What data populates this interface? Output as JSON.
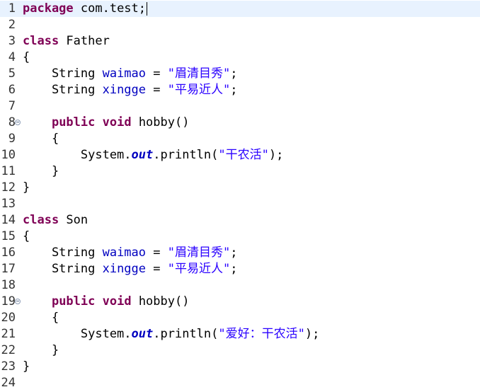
{
  "colors": {
    "keyword": "#7f0055",
    "field": "#0000c0",
    "string": "#2a00ff",
    "current_line": "#e8f2fe",
    "line_number": "#333333"
  },
  "lines": [
    {
      "n": "1",
      "fold": false,
      "current": true,
      "tokens": [
        [
          "kw",
          "package"
        ],
        [
          "txt",
          " com.test;"
        ]
      ]
    },
    {
      "n": "2",
      "fold": false,
      "tokens": []
    },
    {
      "n": "3",
      "fold": false,
      "tokens": [
        [
          "kw",
          "class"
        ],
        [
          "txt",
          " Father"
        ]
      ]
    },
    {
      "n": "4",
      "fold": false,
      "tokens": [
        [
          "txt",
          "{"
        ]
      ]
    },
    {
      "n": "5",
      "fold": false,
      "tokens": [
        [
          "txt",
          "    String "
        ],
        [
          "field",
          "waimao"
        ],
        [
          "txt",
          " = "
        ],
        [
          "str",
          "\"眉清目秀\""
        ],
        [
          "txt",
          ";"
        ]
      ]
    },
    {
      "n": "6",
      "fold": false,
      "tokens": [
        [
          "txt",
          "    String "
        ],
        [
          "field",
          "xingge"
        ],
        [
          "txt",
          " = "
        ],
        [
          "str",
          "\"平易近人\""
        ],
        [
          "txt",
          ";"
        ]
      ]
    },
    {
      "n": "7",
      "fold": false,
      "tokens": []
    },
    {
      "n": "8",
      "fold": true,
      "tokens": [
        [
          "txt",
          "    "
        ],
        [
          "kw",
          "public"
        ],
        [
          "txt",
          " "
        ],
        [
          "kw",
          "void"
        ],
        [
          "txt",
          " hobby()"
        ]
      ]
    },
    {
      "n": "9",
      "fold": false,
      "tokens": [
        [
          "txt",
          "    {"
        ]
      ]
    },
    {
      "n": "10",
      "fold": false,
      "tokens": [
        [
          "txt",
          "        System."
        ],
        [
          "static",
          "out"
        ],
        [
          "txt",
          ".println("
        ],
        [
          "str",
          "\"干农活\""
        ],
        [
          "txt",
          ");"
        ]
      ]
    },
    {
      "n": "11",
      "fold": false,
      "tokens": [
        [
          "txt",
          "    }"
        ]
      ]
    },
    {
      "n": "12",
      "fold": false,
      "tokens": [
        [
          "txt",
          "}"
        ]
      ]
    },
    {
      "n": "13",
      "fold": false,
      "tokens": []
    },
    {
      "n": "14",
      "fold": false,
      "tokens": [
        [
          "kw",
          "class"
        ],
        [
          "txt",
          " Son"
        ]
      ]
    },
    {
      "n": "15",
      "fold": false,
      "tokens": [
        [
          "txt",
          "{"
        ]
      ]
    },
    {
      "n": "16",
      "fold": false,
      "tokens": [
        [
          "txt",
          "    String "
        ],
        [
          "field",
          "waimao"
        ],
        [
          "txt",
          " = "
        ],
        [
          "str",
          "\"眉清目秀\""
        ],
        [
          "txt",
          ";"
        ]
      ]
    },
    {
      "n": "17",
      "fold": false,
      "tokens": [
        [
          "txt",
          "    String "
        ],
        [
          "field",
          "xingge"
        ],
        [
          "txt",
          " = "
        ],
        [
          "str",
          "\"平易近人\""
        ],
        [
          "txt",
          ";"
        ]
      ]
    },
    {
      "n": "18",
      "fold": false,
      "tokens": []
    },
    {
      "n": "19",
      "fold": true,
      "tokens": [
        [
          "txt",
          "    "
        ],
        [
          "kw",
          "public"
        ],
        [
          "txt",
          " "
        ],
        [
          "kw",
          "void"
        ],
        [
          "txt",
          " hobby()"
        ]
      ]
    },
    {
      "n": "20",
      "fold": false,
      "tokens": [
        [
          "txt",
          "    {"
        ]
      ]
    },
    {
      "n": "21",
      "fold": false,
      "tokens": [
        [
          "txt",
          "        System."
        ],
        [
          "static",
          "out"
        ],
        [
          "txt",
          ".println("
        ],
        [
          "str",
          "\"爱好：干农活\""
        ],
        [
          "txt",
          ");"
        ]
      ]
    },
    {
      "n": "22",
      "fold": false,
      "tokens": [
        [
          "txt",
          "    }"
        ]
      ]
    },
    {
      "n": "23",
      "fold": false,
      "tokens": [
        [
          "txt",
          "}"
        ]
      ]
    },
    {
      "n": "24",
      "fold": false,
      "tokens": []
    }
  ]
}
